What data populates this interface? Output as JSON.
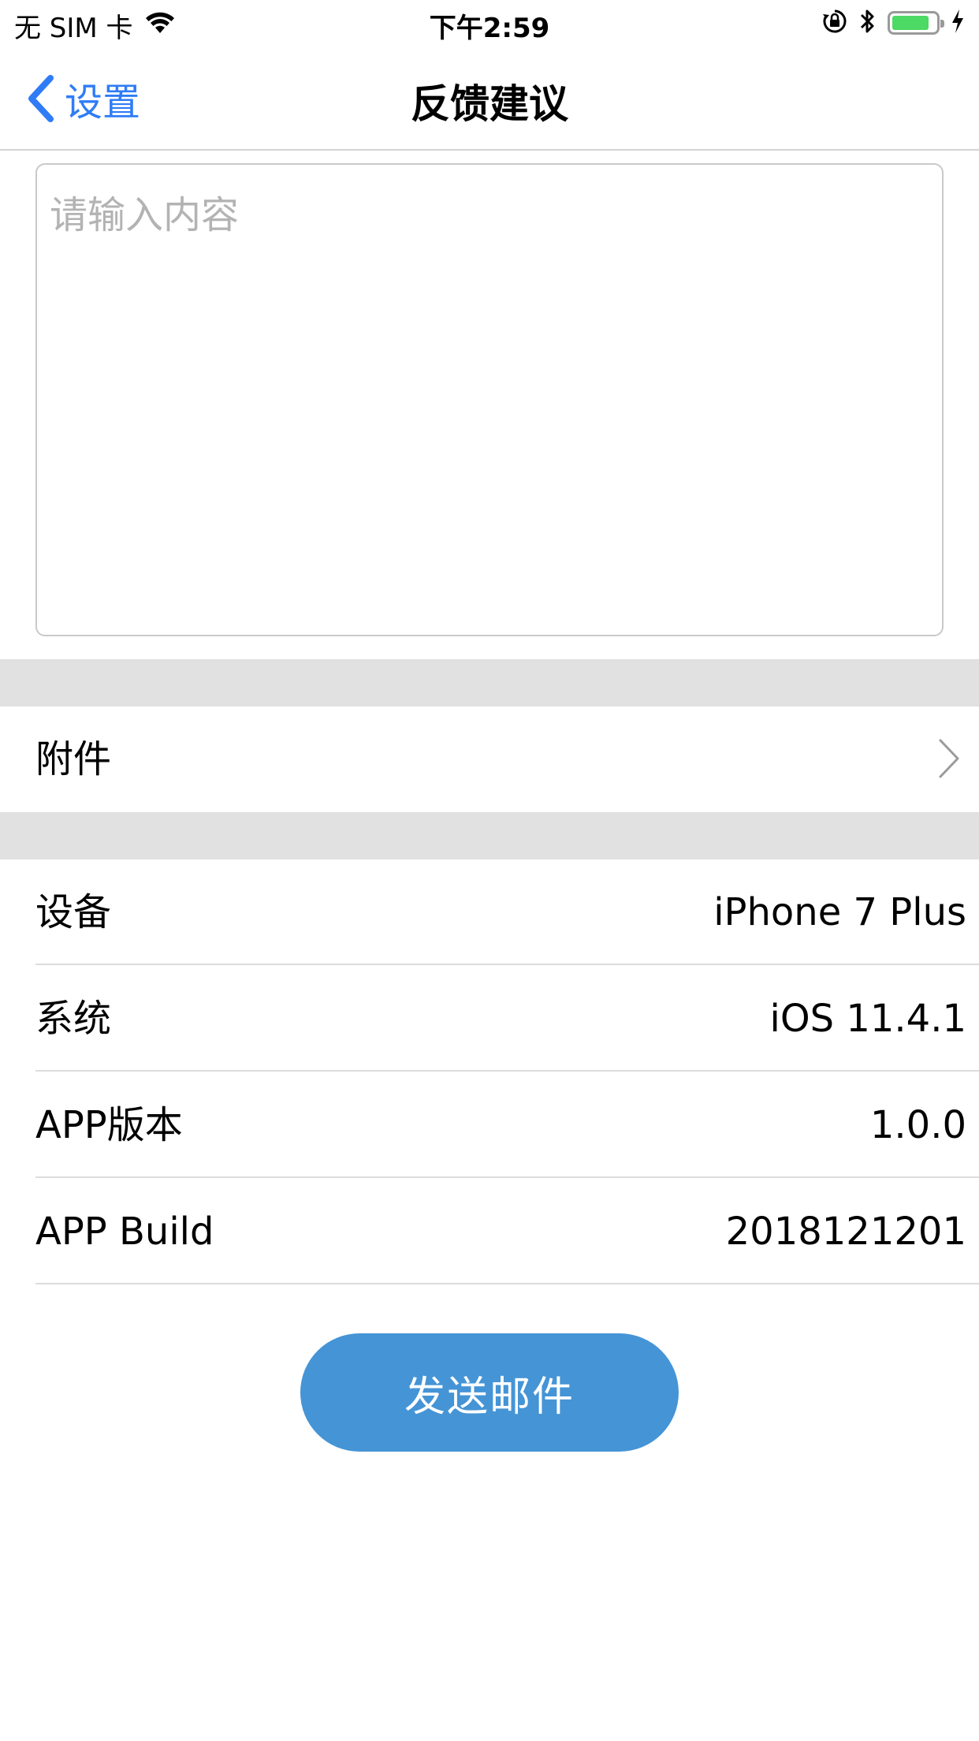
{
  "status_bar": {
    "carrier": "无 SIM 卡",
    "time": "下午2:59",
    "icons": [
      "wifi-icon",
      "rotation-lock-icon",
      "bluetooth-icon",
      "battery-icon",
      "charging-icon"
    ],
    "battery_level": 0.85,
    "battery_color": "#4cd964"
  },
  "nav": {
    "back_label": "设置",
    "title": "反馈建议",
    "accent_color": "#2f7cf6"
  },
  "feedback": {
    "placeholder": "请输入内容",
    "value": ""
  },
  "attachment": {
    "label": "附件"
  },
  "info_rows": [
    {
      "label": "设备",
      "value": "iPhone 7 Plus"
    },
    {
      "label": "系统",
      "value": "iOS 11.4.1"
    },
    {
      "label": "APP版本",
      "value": "1.0.0"
    },
    {
      "label": "APP Build",
      "value": "2018121201"
    }
  ],
  "send_button": {
    "label": "发送邮件",
    "color": "#4594d6"
  }
}
